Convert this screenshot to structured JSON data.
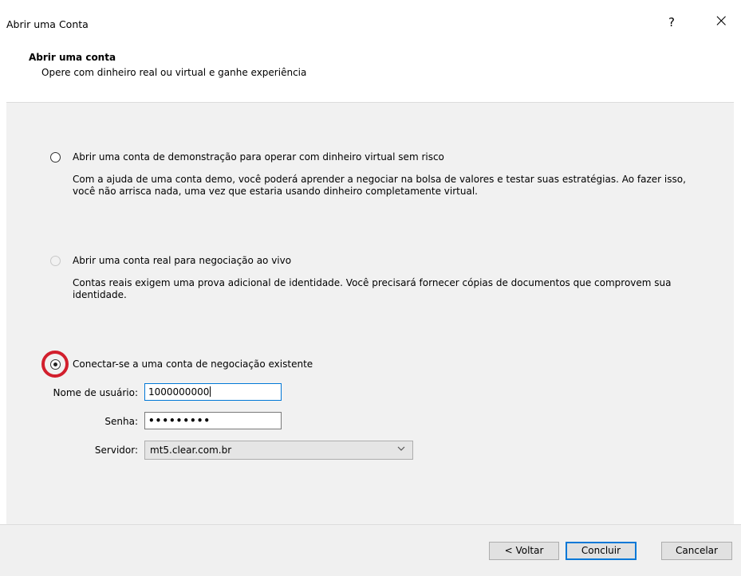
{
  "window": {
    "title": "Abrir uma Conta",
    "help_label": "?",
    "close_label": "×"
  },
  "header": {
    "title": "Abrir uma conta",
    "subtitle": "Opere com dinheiro real ou virtual e ganhe experiência"
  },
  "options": [
    {
      "label": "Abrir uma conta de demonstração para operar com dinheiro virtual sem risco",
      "description": "Com a ajuda de uma conta demo, você poderá aprender a negociar na bolsa de valores e testar suas estratégias. Ao fazer isso, você não arrisca nada, uma vez que estaria usando dinheiro completamente virtual.",
      "selected": false,
      "enabled": true
    },
    {
      "label": "Abrir uma conta real para negociação ao vivo",
      "description": "Contas reais exigem uma prova adicional de identidade. Você precisará fornecer cópias de documentos que comprovem sua identidade.",
      "selected": false,
      "enabled": false
    },
    {
      "label": "Conectar-se a uma conta de negociação existente",
      "selected": true,
      "enabled": true
    }
  ],
  "login": {
    "username_label": "Nome de usuário:",
    "username_value": "1000000000",
    "password_label": "Senha:",
    "password_value": "•••••••••",
    "server_label": "Servidor:",
    "server_value": "mt5.clear.com.br"
  },
  "buttons": {
    "back": "< Voltar",
    "finish": "Concluir",
    "cancel": "Cancelar"
  },
  "colors": {
    "highlight_ring": "#d21f2d",
    "focus_border": "#0078d7"
  }
}
